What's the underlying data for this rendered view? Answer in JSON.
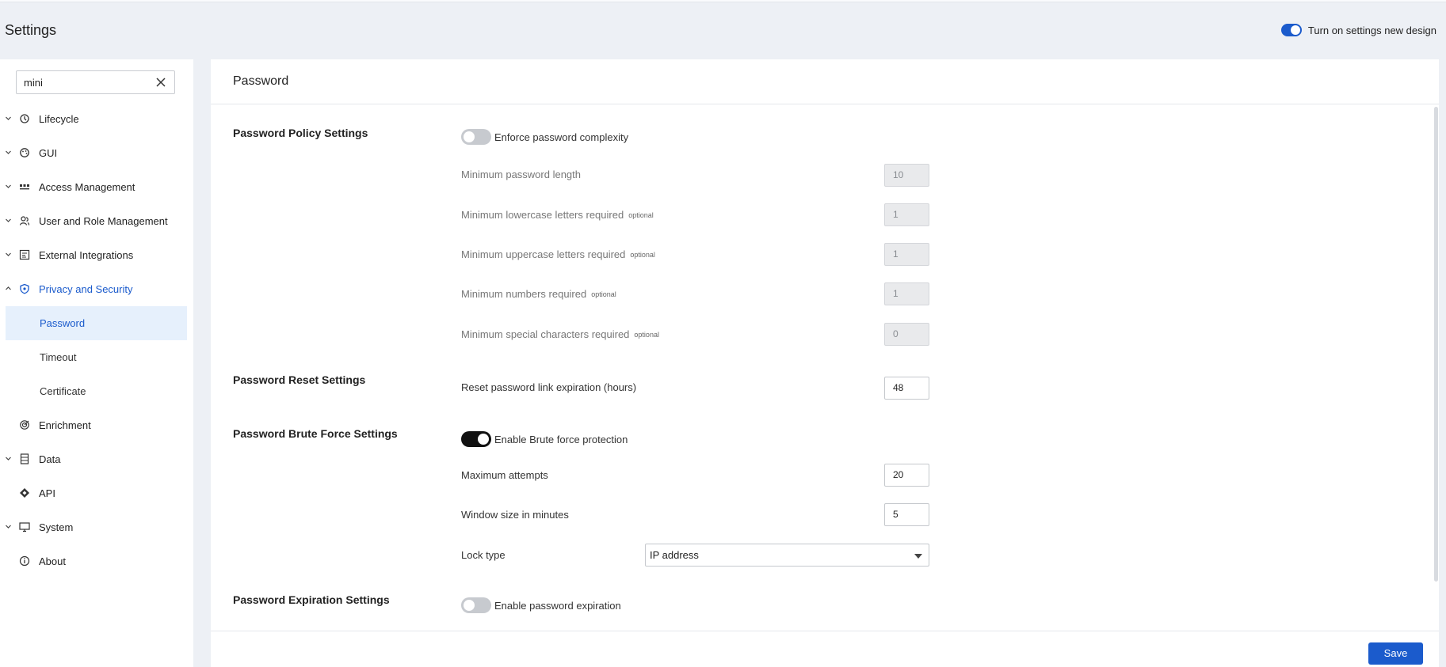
{
  "header": {
    "title": "Settings",
    "new_design_label": "Turn on settings new design",
    "new_design_on": true
  },
  "sidebar": {
    "search_value": "mini",
    "items": [
      {
        "label": "Lifecycle",
        "icon": "lifecycle-icon",
        "expandable": true
      },
      {
        "label": "GUI",
        "icon": "palette-icon",
        "expandable": true
      },
      {
        "label": "Access Management",
        "icon": "access-icon",
        "expandable": true
      },
      {
        "label": "User and Role Management",
        "icon": "users-icon",
        "expandable": true
      },
      {
        "label": "External Integrations",
        "icon": "integrations-icon",
        "expandable": true
      },
      {
        "label": "Privacy and Security",
        "icon": "shield-icon",
        "expandable": true,
        "expanded": true
      },
      {
        "label": "Enrichment",
        "icon": "enrichment-icon",
        "expandable": false
      },
      {
        "label": "Data",
        "icon": "data-icon",
        "expandable": true
      },
      {
        "label": "API",
        "icon": "api-icon",
        "expandable": false
      },
      {
        "label": "System",
        "icon": "monitor-icon",
        "expandable": true
      },
      {
        "label": "About",
        "icon": "info-icon",
        "expandable": false
      }
    ],
    "sub_items": [
      {
        "label": "Password",
        "selected": true
      },
      {
        "label": "Timeout",
        "selected": false
      },
      {
        "label": "Certificate",
        "selected": false
      }
    ]
  },
  "main": {
    "title": "Password",
    "policy": {
      "title": "Password Policy Settings",
      "enforce_label": "Enforce password complexity",
      "enforce_on": false,
      "min_length_label": "Minimum password length",
      "min_length_value": "10",
      "min_lower_label": "Minimum lowercase letters required",
      "min_lower_value": "1",
      "min_upper_label": "Minimum uppercase letters required",
      "min_upper_value": "1",
      "min_numbers_label": "Minimum numbers required",
      "min_numbers_value": "1",
      "min_special_label": "Minimum special characters required",
      "min_special_value": "0",
      "optional_tag": "optional"
    },
    "reset": {
      "title": "Password Reset Settings",
      "expiration_label": "Reset password link expiration (hours)",
      "expiration_value": "48"
    },
    "brute": {
      "title": "Password Brute Force Settings",
      "enable_label": "Enable Brute force protection",
      "enable_on": true,
      "max_attempts_label": "Maximum attempts",
      "max_attempts_value": "20",
      "window_label": "Window size in minutes",
      "window_value": "5",
      "lock_type_label": "Lock type",
      "lock_type_value": "IP address"
    },
    "expiration": {
      "title": "Password Expiration Settings",
      "enable_label": "Enable password expiration",
      "enable_on": false
    },
    "save_label": "Save"
  }
}
